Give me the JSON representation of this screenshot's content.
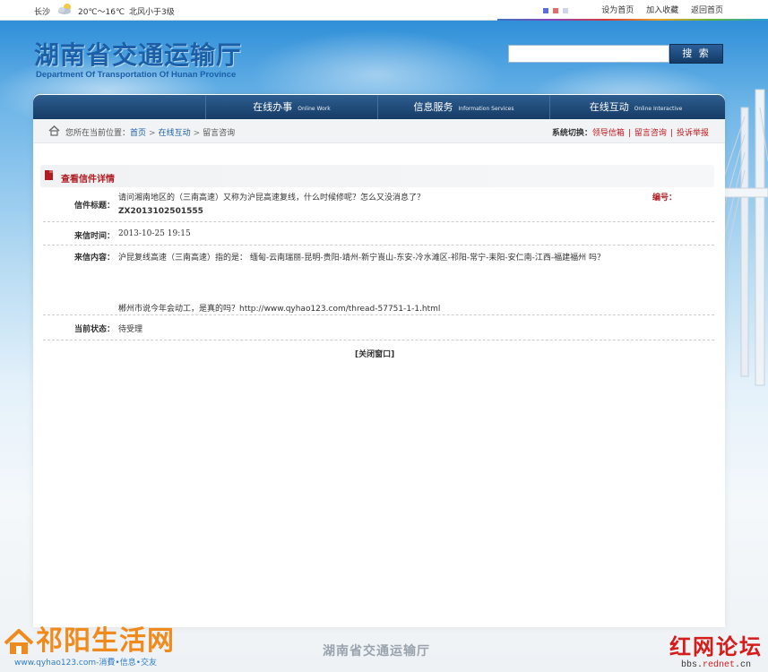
{
  "topbar": {
    "city": "长沙",
    "weather_icon": "partly-cloudy-icon",
    "temperature": "20℃～16℃",
    "wind": "北风小于3级",
    "skin_colors": [
      "#5a6fd6",
      "#e46a6a",
      "#cdd5e6"
    ],
    "links": [
      "设为首页",
      "加入收藏",
      "返回首页"
    ]
  },
  "header": {
    "title_cn": "湖南省交通运输厅",
    "title_en": "Department Of Transportation Of Hunan Province",
    "search_placeholder": "",
    "search_button": "搜 索"
  },
  "nav": {
    "items": [
      {
        "label": "在线办事",
        "sub": "Online Work"
      },
      {
        "label": "信息服务",
        "sub": "Information Services"
      },
      {
        "label": "在线互动",
        "sub": "Online Interactive"
      }
    ]
  },
  "breadcrumb": {
    "prefix": "您所在当前位置：",
    "items": [
      "首页",
      "在线互动",
      "留言咨询"
    ],
    "separator": ">"
  },
  "switcher": {
    "label": "系统切换：",
    "links": [
      "领导信箱",
      "留言咨询",
      "投诉举报"
    ]
  },
  "detail": {
    "section_title": "查看信件详情",
    "subject_label": "信件标题：",
    "subject": "请问湘南地区的（三南高速）又称为沪昆高速复线，什么时候修呢？怎么又没消息了？",
    "subject_code": "ZX2013102501555",
    "number_label": "编号：",
    "date_label": "来信时间：",
    "date": "2013-10-25 19:15",
    "content_label": "来信内容：",
    "content_line1": "沪昆复线高速（三南高速）指的是： 缅甸-云南瑞丽-昆明-贵阳-靖州-新宁崀山-东安-冷水滩区-祁阳-常宁-耒阳-安仁南-江西-福建福州 吗？",
    "content_line2": "郴州市说今年会动工，是真的吗？http://www.qyhao123.com/thread-57751-1-1.html",
    "status_label": "当前状态：",
    "status": "待受理",
    "close_link": "[关闭窗口]"
  },
  "footer": {
    "title": "湖南省交通运输厅"
  },
  "watermarks": {
    "left_logo": "祁阳生活网",
    "left_sub": "www.qyhao123.com-消費•信息•交友",
    "right_logo": "红网论坛",
    "right_sub_a": "bbs.",
    "right_sub_b": "rednet",
    "right_sub_c": ".cn"
  }
}
